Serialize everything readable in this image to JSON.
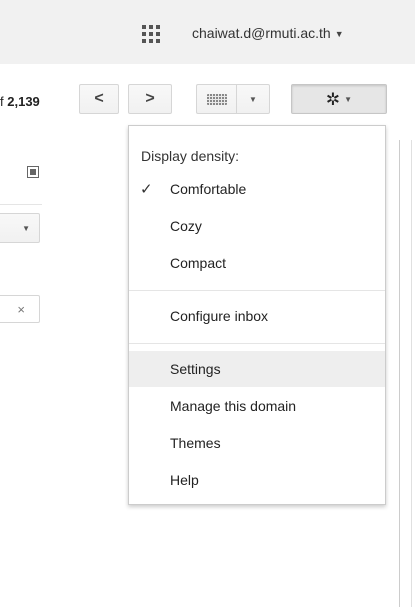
{
  "header": {
    "account": "chaiwat.d@rmuti.ac.th"
  },
  "toolbar": {
    "count_prefix": "f",
    "count_total": "2,139",
    "prev_icon": "chevron-left-icon",
    "next_icon": "chevron-right-icon",
    "keyboard_icon": "keyboard-icon",
    "settings_icon": "gear-icon"
  },
  "menu": {
    "heading": "Display density:",
    "density_options": [
      {
        "label": "Comfortable",
        "checked": true
      },
      {
        "label": "Cozy",
        "checked": false
      },
      {
        "label": "Compact",
        "checked": false
      }
    ],
    "configure": "Configure inbox",
    "items": [
      "Settings",
      "Manage this domain",
      "Themes",
      "Help"
    ],
    "highlighted": "Settings"
  },
  "left_panel": {
    "clear_symbol": "×"
  }
}
